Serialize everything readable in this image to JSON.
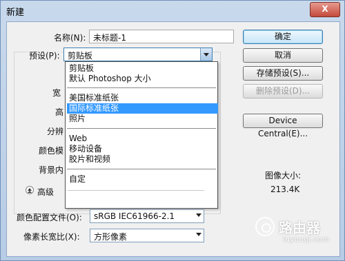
{
  "window": {
    "title": "新建",
    "close_symbol": "X"
  },
  "form": {
    "name_label": "名称(N):",
    "name_value": "未标题-1",
    "preset_label": "预设(P):",
    "preset_value": "剪贴板",
    "width_label_partial": "宽",
    "height_label_partial": "高",
    "resolution_label_partial": "分辨",
    "color_mode_label_partial": "颜色模",
    "background_label_partial": "背景内"
  },
  "preset_menu": {
    "items": [
      {
        "label": "剪贴板",
        "selected": false
      },
      {
        "label": "默认 Photoshop 大小",
        "selected": false
      },
      {
        "label": "美国标准纸张",
        "selected": false
      },
      {
        "label": "国际标准纸张",
        "selected": true
      },
      {
        "label": "照片",
        "selected": false
      },
      {
        "label": "Web",
        "selected": false
      },
      {
        "label": "移动设备",
        "selected": false
      },
      {
        "label": "胶片和视频",
        "selected": false
      },
      {
        "label": "自定",
        "selected": false
      }
    ]
  },
  "advanced": {
    "toggle_label": "高级",
    "color_profile_label": "颜色配置文件(O):",
    "color_profile_value": "sRGB IEC61966-2.1",
    "pixel_aspect_label": "像素长宽比(X):",
    "pixel_aspect_value": "方形像素"
  },
  "buttons": {
    "ok": "确定",
    "cancel": "取消",
    "save_preset": "存储预设(S)...",
    "delete_preset": "删除预设(D)...",
    "device_central": "Device Central(E)..."
  },
  "image_size": {
    "label": "图像大小:",
    "value": "213.4K"
  },
  "watermark": {
    "brand": "路由器",
    "url": "luyouqi.com"
  },
  "colors": {
    "selection": "#3399ff",
    "title_bg": "#c9d9ec",
    "default_btn": "#c8e6f8"
  }
}
